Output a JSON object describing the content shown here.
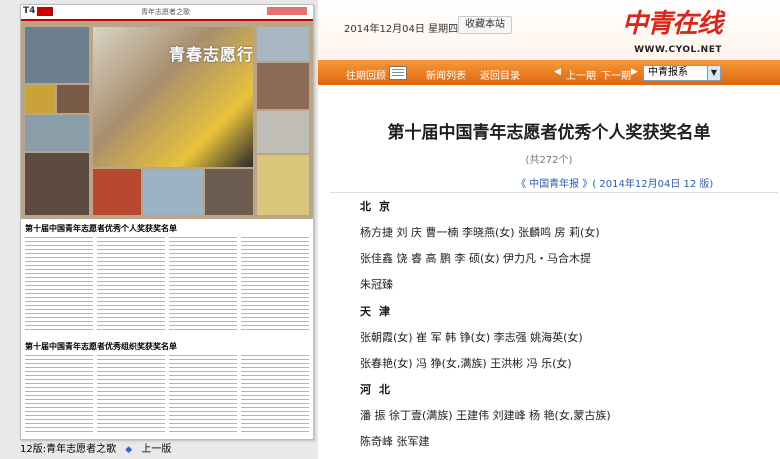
{
  "paper": {
    "page_no": "T4",
    "section": "青年志愿者之歌",
    "collage_title": "青春志愿行",
    "list1_title": "第十届中国青年志愿者优秀个人奖获奖名单",
    "list2_title": "第十届中国青年志愿者优秀组织奖获奖名单",
    "footer_label": "12版:青年志愿者之歌",
    "prev_label": "上一版"
  },
  "header": {
    "date": "2014年12月04日  星期四",
    "favorite_btn": "收藏本站",
    "logo_text": "中青在线",
    "url": "WWW.CYOL.NET"
  },
  "nav": {
    "history": "往期回顾",
    "news_list": "新闻列表",
    "back_to_index": "返回目录",
    "prev_page": "上一期",
    "next_page": "下一期",
    "paper_select": "中青报系"
  },
  "article": {
    "title": "第十届中国青年志愿者优秀个人奖获奖名单",
    "count": "(共272个)",
    "source": "《  中国青年报  》( 2014年12月04日    12  版)",
    "regions": [
      {
        "name": "北京",
        "lines": [
          "杨方捷    刘    庆    曹一楠    李晓燕(女)      张麟鸣    房    莉(女)",
          "张佳鑫    饶    睿  高    鹏    李    硕(女)      伊力凡・马合木提",
          "朱冠臻"
        ]
      },
      {
        "name": "天津",
        "lines": [
          "张朝霞(女)    崔    军    韩    铮(女)    李志强      姚海英(女)",
          "张春艳(女)    冯    狰(女,满族)        王洪彬      冯    乐(女)"
        ]
      },
      {
        "name": "河北",
        "lines": [
          "潘    振    徐丁壹(满族)    王建伟    刘建峰    杨    艳(女,蒙古族)",
          "陈奇峰    张军建"
        ]
      }
    ]
  },
  "colors": {
    "nav_orange": "#e1660f",
    "logo_red": "#d7281c",
    "link_blue": "#2a5ea8"
  }
}
